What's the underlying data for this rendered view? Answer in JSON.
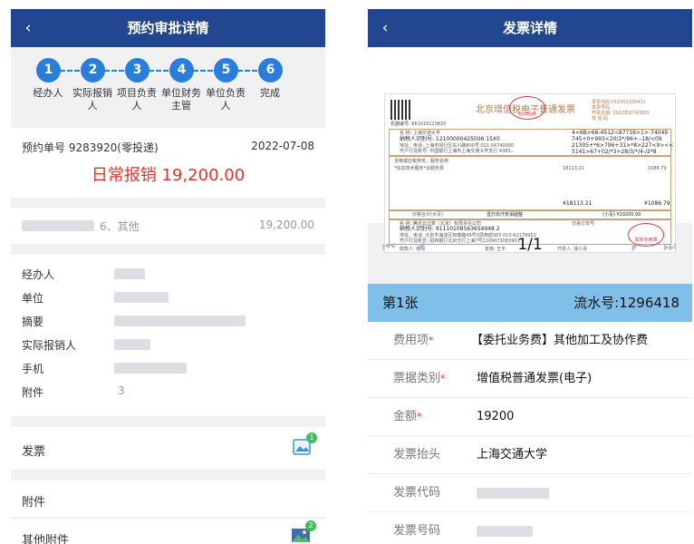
{
  "left": {
    "header": {
      "title": "预约审批详情",
      "back": "‹"
    },
    "steps": [
      {
        "num": "1",
        "label": "经办人"
      },
      {
        "num": "2",
        "label": "实际报销\n人"
      },
      {
        "num": "3",
        "label": "项目负责\n人"
      },
      {
        "num": "4",
        "label": "单位财务\n主管"
      },
      {
        "num": "5",
        "label": "单位负责\n人"
      },
      {
        "num": "6",
        "label": "完成"
      }
    ],
    "summary": {
      "order_no": "预约单号 9283920(零投递)",
      "date": "2022-07-08",
      "title": "日常报销 19,200.00",
      "accent_color": "#e4322b"
    },
    "expense_item": {
      "name": "6、其他",
      "amount": "19,200.00"
    },
    "details": [
      {
        "label": "经办人",
        "value": ""
      },
      {
        "label": "单位",
        "value": ""
      },
      {
        "label": "摘要",
        "value": ""
      },
      {
        "label": "实际报销人",
        "value": ""
      },
      {
        "label": "手机",
        "value": ""
      },
      {
        "label": "附件",
        "value": "3"
      }
    ],
    "invoice_section": {
      "label": "发票",
      "badge": "1",
      "icon": "image-icon"
    },
    "attachment_section": {
      "label": "附件"
    },
    "other_attachment_section": {
      "label": "其他附件",
      "badge": "2",
      "icon": "photo-icon"
    }
  },
  "right": {
    "header": {
      "title": "发票详情",
      "back": "‹"
    },
    "invoice_image": {
      "title": "北京增值税电子普通发票",
      "seal_text": "税务局监制",
      "code_line": "发票代码:011002200411",
      "number_line": "发票号码:",
      "date_line": "开票日期: 2022年07月08日",
      "check_line": "校 验 码:",
      "machine_no": "机器编号: 661616120820",
      "buyer_name": "名    称: 上海交通大学",
      "buyer_tax_id": "纳税人识别号: 12100000425006 15X0",
      "buyer_addr": "地址、电话: 上海市闵行区东川路800号 021-54740000",
      "buyer_bank": "开户行及账号: 中国银行上海市上海交通大学支行 4383...",
      "cipher1": "4<6B>66-4512<87716>1>-74049",
      "cipher2": "745+0+993<20/2*/96+--18/<09",
      "cipher3": "21305+*6>796+31>*8>227<9><<",
      "cipher4": "5141>67+02/*3+28/3/*/4-/2*8",
      "item_hdr": "货物或应税劳务、服务名称",
      "item_row": "*信息技术服务*云服务费",
      "item_amount": "18113.21",
      "item_tax": "1086.79",
      "subtotal": "¥18113.21",
      "subtotal_tax": "¥1086.79",
      "total_words_label": "价税合计(大写)",
      "total_words": "壹万玖仟贰佰圆整",
      "total_small": "(小写) ¥19200.00",
      "seller_name": "名    称: 腾讯云计算（北京）有限责任公司",
      "seller_tax_id": "纳税人识别号: 91110108563654948 2",
      "seller_addr": "地址、电话: 北京市海淀区知春路49号3层西部303 010-62179952",
      "seller_bank": "开户行及账号: 招商银行北京分行上海7号1109073083901",
      "remark": "交易订单号:",
      "payee": "收款人: 杨燕",
      "reviewer": "复核: 王平",
      "issuer": "开票人: 徐小青",
      "seller_stamp": "发票专用章"
    },
    "pager": {
      "text": "1/1"
    },
    "sheet_header": {
      "label": "第1张",
      "serial": "流水号:1296418"
    },
    "fields": [
      {
        "label": "费用项",
        "required": true,
        "value": "【委托业务费】其他加工及协作费"
      },
      {
        "label": "票据类别",
        "required": true,
        "value": "增值税普通发票(电子)"
      },
      {
        "label": "金额",
        "required": true,
        "value": "19200"
      },
      {
        "label": "发票抬头",
        "required": false,
        "value": "上海交通大学"
      },
      {
        "label": "发票代码",
        "required": false,
        "value": ""
      },
      {
        "label": "发票号码",
        "required": false,
        "value": ""
      }
    ],
    "required_mark": "*"
  }
}
